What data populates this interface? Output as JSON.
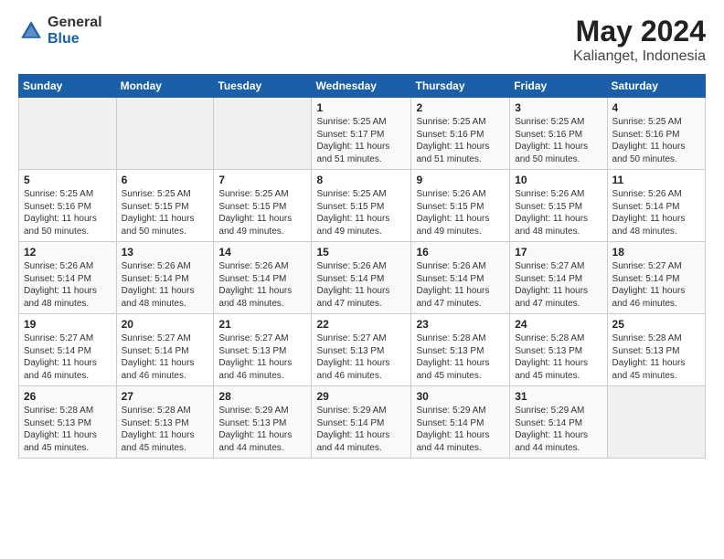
{
  "logo": {
    "general": "General",
    "blue": "Blue"
  },
  "title": {
    "month": "May 2024",
    "location": "Kalianget, Indonesia"
  },
  "weekdays": [
    "Sunday",
    "Monday",
    "Tuesday",
    "Wednesday",
    "Thursday",
    "Friday",
    "Saturday"
  ],
  "weeks": [
    [
      {
        "day": "",
        "info": ""
      },
      {
        "day": "",
        "info": ""
      },
      {
        "day": "",
        "info": ""
      },
      {
        "day": "1",
        "info": "Sunrise: 5:25 AM\nSunset: 5:17 PM\nDaylight: 11 hours\nand 51 minutes."
      },
      {
        "day": "2",
        "info": "Sunrise: 5:25 AM\nSunset: 5:16 PM\nDaylight: 11 hours\nand 51 minutes."
      },
      {
        "day": "3",
        "info": "Sunrise: 5:25 AM\nSunset: 5:16 PM\nDaylight: 11 hours\nand 50 minutes."
      },
      {
        "day": "4",
        "info": "Sunrise: 5:25 AM\nSunset: 5:16 PM\nDaylight: 11 hours\nand 50 minutes."
      }
    ],
    [
      {
        "day": "5",
        "info": "Sunrise: 5:25 AM\nSunset: 5:16 PM\nDaylight: 11 hours\nand 50 minutes."
      },
      {
        "day": "6",
        "info": "Sunrise: 5:25 AM\nSunset: 5:15 PM\nDaylight: 11 hours\nand 50 minutes."
      },
      {
        "day": "7",
        "info": "Sunrise: 5:25 AM\nSunset: 5:15 PM\nDaylight: 11 hours\nand 49 minutes."
      },
      {
        "day": "8",
        "info": "Sunrise: 5:25 AM\nSunset: 5:15 PM\nDaylight: 11 hours\nand 49 minutes."
      },
      {
        "day": "9",
        "info": "Sunrise: 5:26 AM\nSunset: 5:15 PM\nDaylight: 11 hours\nand 49 minutes."
      },
      {
        "day": "10",
        "info": "Sunrise: 5:26 AM\nSunset: 5:15 PM\nDaylight: 11 hours\nand 48 minutes."
      },
      {
        "day": "11",
        "info": "Sunrise: 5:26 AM\nSunset: 5:14 PM\nDaylight: 11 hours\nand 48 minutes."
      }
    ],
    [
      {
        "day": "12",
        "info": "Sunrise: 5:26 AM\nSunset: 5:14 PM\nDaylight: 11 hours\nand 48 minutes."
      },
      {
        "day": "13",
        "info": "Sunrise: 5:26 AM\nSunset: 5:14 PM\nDaylight: 11 hours\nand 48 minutes."
      },
      {
        "day": "14",
        "info": "Sunrise: 5:26 AM\nSunset: 5:14 PM\nDaylight: 11 hours\nand 48 minutes."
      },
      {
        "day": "15",
        "info": "Sunrise: 5:26 AM\nSunset: 5:14 PM\nDaylight: 11 hours\nand 47 minutes."
      },
      {
        "day": "16",
        "info": "Sunrise: 5:26 AM\nSunset: 5:14 PM\nDaylight: 11 hours\nand 47 minutes."
      },
      {
        "day": "17",
        "info": "Sunrise: 5:27 AM\nSunset: 5:14 PM\nDaylight: 11 hours\nand 47 minutes."
      },
      {
        "day": "18",
        "info": "Sunrise: 5:27 AM\nSunset: 5:14 PM\nDaylight: 11 hours\nand 46 minutes."
      }
    ],
    [
      {
        "day": "19",
        "info": "Sunrise: 5:27 AM\nSunset: 5:14 PM\nDaylight: 11 hours\nand 46 minutes."
      },
      {
        "day": "20",
        "info": "Sunrise: 5:27 AM\nSunset: 5:14 PM\nDaylight: 11 hours\nand 46 minutes."
      },
      {
        "day": "21",
        "info": "Sunrise: 5:27 AM\nSunset: 5:13 PM\nDaylight: 11 hours\nand 46 minutes."
      },
      {
        "day": "22",
        "info": "Sunrise: 5:27 AM\nSunset: 5:13 PM\nDaylight: 11 hours\nand 46 minutes."
      },
      {
        "day": "23",
        "info": "Sunrise: 5:28 AM\nSunset: 5:13 PM\nDaylight: 11 hours\nand 45 minutes."
      },
      {
        "day": "24",
        "info": "Sunrise: 5:28 AM\nSunset: 5:13 PM\nDaylight: 11 hours\nand 45 minutes."
      },
      {
        "day": "25",
        "info": "Sunrise: 5:28 AM\nSunset: 5:13 PM\nDaylight: 11 hours\nand 45 minutes."
      }
    ],
    [
      {
        "day": "26",
        "info": "Sunrise: 5:28 AM\nSunset: 5:13 PM\nDaylight: 11 hours\nand 45 minutes."
      },
      {
        "day": "27",
        "info": "Sunrise: 5:28 AM\nSunset: 5:13 PM\nDaylight: 11 hours\nand 45 minutes."
      },
      {
        "day": "28",
        "info": "Sunrise: 5:29 AM\nSunset: 5:13 PM\nDaylight: 11 hours\nand 44 minutes."
      },
      {
        "day": "29",
        "info": "Sunrise: 5:29 AM\nSunset: 5:14 PM\nDaylight: 11 hours\nand 44 minutes."
      },
      {
        "day": "30",
        "info": "Sunrise: 5:29 AM\nSunset: 5:14 PM\nDaylight: 11 hours\nand 44 minutes."
      },
      {
        "day": "31",
        "info": "Sunrise: 5:29 AM\nSunset: 5:14 PM\nDaylight: 11 hours\nand 44 minutes."
      },
      {
        "day": "",
        "info": ""
      }
    ]
  ]
}
